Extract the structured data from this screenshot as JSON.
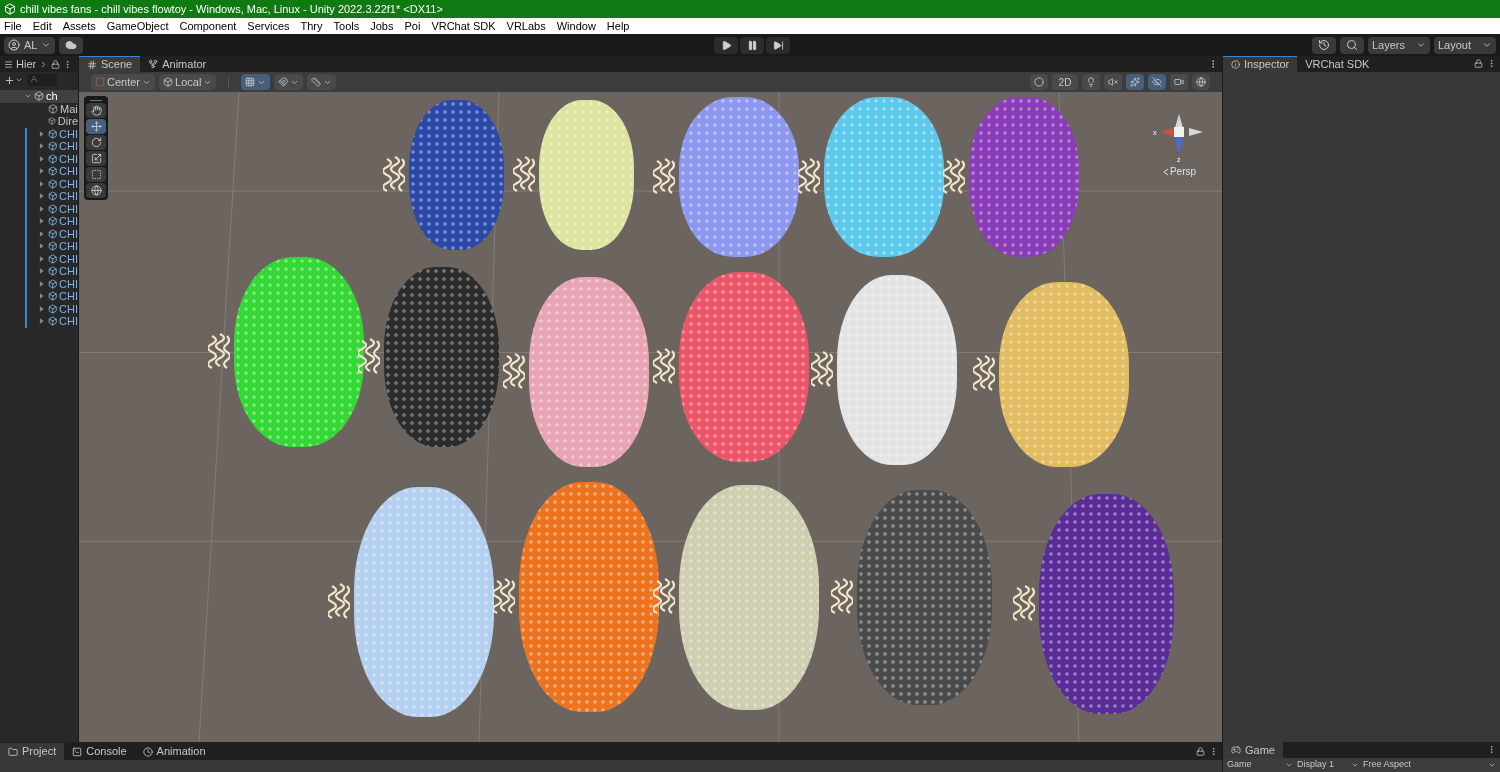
{
  "window": {
    "title": "chill vibes fans - chill vibes flowtoy - Windows, Mac, Linux - Unity 2022.3.22f1* <DX11>"
  },
  "menu": [
    "File",
    "Edit",
    "Assets",
    "GameObject",
    "Component",
    "Services",
    "Thry",
    "Tools",
    "Jobs",
    "Poi",
    "VRChat SDK",
    "VRLabs",
    "Window",
    "Help"
  ],
  "toolbar": {
    "account": "AL",
    "play_buttons": [
      {
        "kind": "play",
        "selected": false
      },
      {
        "kind": "pause",
        "selected": false
      },
      {
        "kind": "step",
        "selected": false
      }
    ],
    "layers": "Layers",
    "layout": "Layout"
  },
  "hierarchy": {
    "title": "Hier",
    "search": {
      "placeholder": "A"
    },
    "root": {
      "label": "ch",
      "expanded": true,
      "selected": true,
      "children": [
        {
          "label": "Mai",
          "kind": "object"
        },
        {
          "label": "Dire",
          "kind": "object"
        },
        {
          "label": "CHI",
          "kind": "prefab",
          "expanded": false
        },
        {
          "label": "CHI",
          "kind": "prefab",
          "expanded": false
        },
        {
          "label": "CHI",
          "kind": "prefab",
          "expanded": false
        },
        {
          "label": "CHI",
          "kind": "prefab",
          "expanded": false
        },
        {
          "label": "CHI",
          "kind": "prefab",
          "expanded": false
        },
        {
          "label": "CHI",
          "kind": "prefab",
          "expanded": false
        },
        {
          "label": "CHI",
          "kind": "prefab",
          "expanded": false
        },
        {
          "label": "CHI",
          "kind": "prefab",
          "expanded": false
        },
        {
          "label": "CHI",
          "kind": "prefab",
          "expanded": false
        },
        {
          "label": "CHI",
          "kind": "prefab",
          "expanded": false
        },
        {
          "label": "CHI",
          "kind": "prefab",
          "expanded": false
        },
        {
          "label": "CHI",
          "kind": "prefab",
          "expanded": false
        },
        {
          "label": "CHI",
          "kind": "prefab",
          "expanded": false
        },
        {
          "label": "CHI",
          "kind": "prefab",
          "expanded": false
        },
        {
          "label": "CHI",
          "kind": "prefab",
          "expanded": false
        },
        {
          "label": "CHI",
          "kind": "prefab",
          "expanded": false
        }
      ]
    }
  },
  "scene_tabs": [
    {
      "label": "Scene",
      "kind": "scene",
      "selected": true
    },
    {
      "label": "Animator",
      "kind": "animator",
      "selected": false
    }
  ],
  "scene_toolbar": {
    "pivot": "Center",
    "space": "Local",
    "left_toggles": [
      {
        "kind": "grid",
        "selected": true
      },
      {
        "kind": "snap",
        "selected": false
      },
      {
        "kind": "increment",
        "selected": false
      }
    ],
    "right_toggles": [
      {
        "kind": "shading",
        "selected": false
      },
      {
        "kind": "dimension",
        "label": "2D",
        "selected": false
      },
      {
        "kind": "light",
        "selected": false
      },
      {
        "kind": "audio",
        "selected": false
      },
      {
        "kind": "effects",
        "selected": true
      },
      {
        "kind": "hidden",
        "selected": true
      },
      {
        "kind": "camera",
        "selected": false
      },
      {
        "kind": "gizmos",
        "selected": false
      }
    ]
  },
  "tools": [
    {
      "kind": "hand",
      "selected": false
    },
    {
      "kind": "move",
      "selected": true
    },
    {
      "kind": "rotate",
      "selected": false
    },
    {
      "kind": "scale",
      "selected": false
    },
    {
      "kind": "rect",
      "selected": false
    },
    {
      "kind": "transform",
      "selected": false
    }
  ],
  "gizmo": {
    "x_label": "x",
    "z_label": "z",
    "projection": "Persp"
  },
  "objects": [
    {
      "color": "#2a48a8"
    },
    {
      "color": "#dfe3a0"
    },
    {
      "color": "#8c98f0"
    },
    {
      "color": "#5cc8ec"
    },
    {
      "color": "#8a3cb8"
    },
    {
      "color": "#34d834"
    },
    {
      "color": "#2c2c2c"
    },
    {
      "color": "#e8a4b4"
    },
    {
      "color": "#ec5468"
    },
    {
      "color": "#e4e4e4"
    },
    {
      "color": "#e2bc60"
    },
    {
      "color": "#b4d0f0"
    },
    {
      "color": "#ec7420"
    },
    {
      "color": "#cfceb0"
    },
    {
      "color": "#4a4a4a"
    },
    {
      "color": "#5a2c98"
    }
  ],
  "inspector_tabs": [
    {
      "label": "Inspector",
      "selected": true
    },
    {
      "label": "VRChat SDK",
      "selected": false
    }
  ],
  "bottom_tabs": [
    {
      "label": "Project",
      "kind": "project",
      "selected": true
    },
    {
      "label": "Console",
      "kind": "console",
      "selected": false
    },
    {
      "label": "Animation",
      "kind": "animation",
      "selected": false
    }
  ],
  "game": {
    "tab": "Game",
    "view": "Game",
    "display": "Display 1",
    "aspect": "Free Aspect"
  }
}
